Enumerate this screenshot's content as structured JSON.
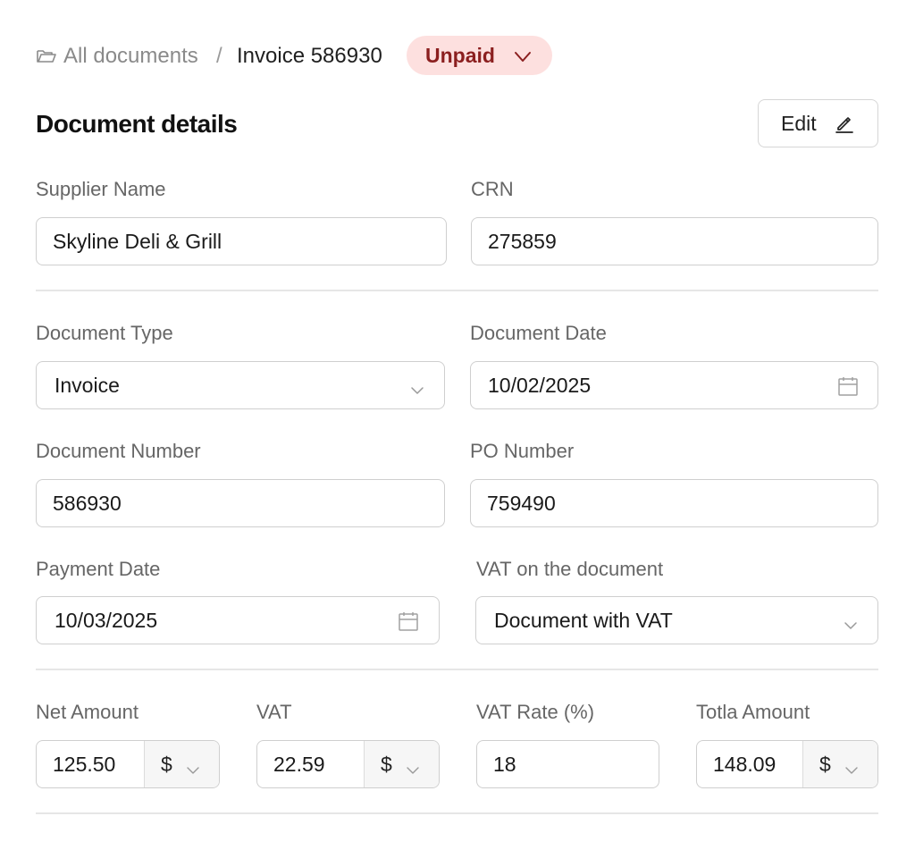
{
  "breadcrumb": {
    "root_label": "All documents",
    "separator": "/",
    "current_label": "Invoice 586930",
    "status": "Unpaid"
  },
  "header": {
    "title": "Document details",
    "edit_label": "Edit"
  },
  "fields": {
    "supplier_name": {
      "label": "Supplier Name",
      "value": "Skyline Deli & Grill"
    },
    "crn": {
      "label": "CRN",
      "value": "275859"
    },
    "document_type": {
      "label": "Document Type",
      "value": "Invoice"
    },
    "document_date": {
      "label": "Document Date",
      "value": "10/02/2025"
    },
    "document_number": {
      "label": "Document Number",
      "value": "586930"
    },
    "po_number": {
      "label": "PO Number",
      "value": "759490"
    },
    "payment_date": {
      "label": "Payment Date",
      "value": "10/03/2025"
    },
    "vat_on_document": {
      "label": "VAT on the document",
      "value": "Document with VAT"
    },
    "net_amount": {
      "label": "Net Amount",
      "value": "125.50",
      "currency": "$"
    },
    "vat": {
      "label": "VAT",
      "value": "22.59",
      "currency": "$"
    },
    "vat_rate": {
      "label": "VAT Rate (%)",
      "value": "18"
    },
    "total_amount": {
      "label": "Totla Amount",
      "value": "148.09",
      "currency": "$"
    }
  },
  "colors": {
    "badge_bg": "#fde0df",
    "badge_text": "#8b1f1f",
    "border": "#cfcfcf",
    "divider": "#e6e6e6"
  },
  "icons": [
    "folder-icon",
    "chevron-down-icon",
    "pencil-icon",
    "calendar-icon"
  ]
}
